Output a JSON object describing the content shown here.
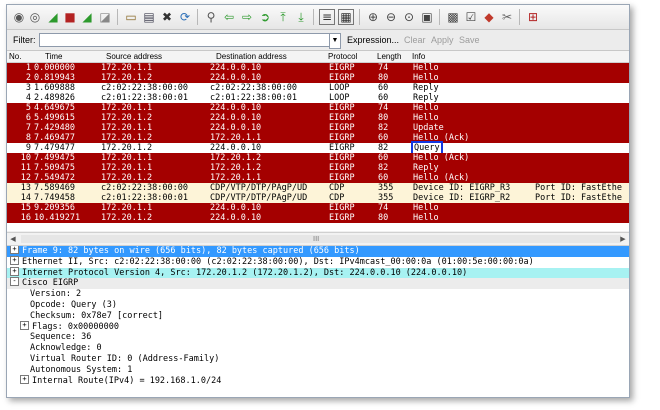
{
  "toolbar": {
    "icons": [
      "list-interfaces-icon",
      "capture-options-icon",
      "start-capture-icon",
      "stop-capture-icon",
      "restart-capture-icon",
      "open-file-icon",
      "save-file-icon",
      "close-file-icon",
      "reload-icon",
      "find-packet-icon",
      "go-back-icon",
      "go-forward-icon",
      "go-to-packet-icon",
      "go-first-icon",
      "go-last-icon",
      "colorize-icon",
      "autoscroll-icon",
      "zoom-in-icon",
      "zoom-out-icon",
      "zoom-normal-icon",
      "resize-columns-icon",
      "capture-filters-icon",
      "display-filters-icon",
      "coloring-rules-icon",
      "preferences-icon",
      "help-icon"
    ]
  },
  "filter": {
    "label": "Filter:",
    "value": "",
    "expression_label": "Expression...",
    "clear_label": "Clear",
    "apply_label": "Apply",
    "save_label": "Save"
  },
  "packet_list": {
    "columns": [
      "No.",
      "Time",
      "Source address",
      "Destination address",
      "Protocol",
      "Length",
      "Info"
    ],
    "rows": [
      {
        "no": "1",
        "time": "0.000000",
        "src": "172.20.1.1",
        "dst": "224.0.0.10",
        "proto": "EIGRP",
        "len": "74",
        "info": "Hello",
        "type": "eigrp"
      },
      {
        "no": "2",
        "time": "0.819943",
        "src": "172.20.1.2",
        "dst": "224.0.0.10",
        "proto": "EIGRP",
        "len": "80",
        "info": "Hello",
        "type": "eigrp"
      },
      {
        "no": "3",
        "time": "1.609888",
        "src": "c2:02:22:38:00:00",
        "dst": "c2:02:22:38:00:00",
        "proto": "LOOP",
        "len": "60",
        "info": "Reply",
        "type": "loop"
      },
      {
        "no": "4",
        "time": "2.489826",
        "src": "c2:01:22:38:00:01",
        "dst": "c2:01:22:38:00:01",
        "proto": "LOOP",
        "len": "60",
        "info": "Reply",
        "type": "loop"
      },
      {
        "no": "5",
        "time": "4.649675",
        "src": "172.20.1.1",
        "dst": "224.0.0.10",
        "proto": "EIGRP",
        "len": "74",
        "info": "Hello",
        "type": "eigrp"
      },
      {
        "no": "6",
        "time": "5.499615",
        "src": "172.20.1.2",
        "dst": "224.0.0.10",
        "proto": "EIGRP",
        "len": "80",
        "info": "Hello",
        "type": "eigrp"
      },
      {
        "no": "7",
        "time": "7.429480",
        "src": "172.20.1.1",
        "dst": "224.0.0.10",
        "proto": "EIGRP",
        "len": "82",
        "info": "Update",
        "type": "eigrp"
      },
      {
        "no": "8",
        "time": "7.469477",
        "src": "172.20.1.2",
        "dst": "172.20.1.1",
        "proto": "EIGRP",
        "len": "60",
        "info": "Hello (Ack)",
        "type": "eigrp"
      },
      {
        "no": "9",
        "time": "7.479477",
        "src": "172.20.1.2",
        "dst": "224.0.0.10",
        "proto": "EIGRP",
        "len": "82",
        "info": "Query",
        "type": "selected"
      },
      {
        "no": "10",
        "time": "7.499475",
        "src": "172.20.1.1",
        "dst": "172.20.1.2",
        "proto": "EIGRP",
        "len": "60",
        "info": "Hello (Ack)",
        "type": "eigrp"
      },
      {
        "no": "11",
        "time": "7.509475",
        "src": "172.20.1.1",
        "dst": "172.20.1.2",
        "proto": "EIGRP",
        "len": "82",
        "info": "Reply",
        "type": "eigrp"
      },
      {
        "no": "12",
        "time": "7.549472",
        "src": "172.20.1.2",
        "dst": "172.20.1.1",
        "proto": "EIGRP",
        "len": "60",
        "info": "Hello (Ack)",
        "type": "eigrp"
      },
      {
        "no": "13",
        "time": "7.589469",
        "src": "c2:02:22:38:00:00",
        "dst": "CDP/VTP/DTP/PAgP/UD",
        "proto": "CDP",
        "len": "355",
        "info": "Device ID: EIGRP_R3",
        "port": "Port ID: FastEthe",
        "type": "cdp"
      },
      {
        "no": "14",
        "time": "7.749458",
        "src": "c2:01:22:38:00:01",
        "dst": "CDP/VTP/DTP/PAgP/UD",
        "proto": "CDP",
        "len": "355",
        "info": "Device ID: EIGRP_R2",
        "port": "Port ID: FastEthe",
        "type": "cdp"
      },
      {
        "no": "15",
        "time": "9.209356",
        "src": "172.20.1.1",
        "dst": "224.0.0.10",
        "proto": "EIGRP",
        "len": "74",
        "info": "Hello",
        "type": "eigrp"
      },
      {
        "no": "16",
        "time": "10.419271",
        "src": "172.20.1.2",
        "dst": "224.0.0.10",
        "proto": "EIGRP",
        "len": "80",
        "info": "Hello",
        "type": "eigrp"
      }
    ]
  },
  "scrollbar": {
    "grip": "III"
  },
  "details": {
    "lines": [
      {
        "text": "Frame 9: 82 bytes on wire (656 bits), 82 bytes captured (656 bits)",
        "indent": 0,
        "expander": "+",
        "style": "sel"
      },
      {
        "text": "Ethernet II, Src: c2:02:22:38:00:00 (c2:02:22:38:00:00), Dst: IPv4mcast_00:00:0a (01:00:5e:00:00:0a)",
        "indent": 0,
        "expander": "+",
        "style": ""
      },
      {
        "text": "Internet Protocol Version 4, Src: 172.20.1.2 (172.20.1.2), Dst: 224.0.0.10 (224.0.0.10)",
        "indent": 0,
        "expander": "+",
        "style": "ip"
      },
      {
        "text": "Cisco EIGRP",
        "indent": 0,
        "expander": "-",
        "style": "cisco"
      },
      {
        "text": "Version: 2",
        "indent": 2,
        "expander": "",
        "style": ""
      },
      {
        "text": "Opcode: Query (3)",
        "indent": 2,
        "expander": "",
        "style": ""
      },
      {
        "text": "Checksum: 0x78e7 [correct]",
        "indent": 2,
        "expander": "",
        "style": ""
      },
      {
        "text": "Flags: 0x00000000",
        "indent": 1,
        "expander": "+",
        "style": ""
      },
      {
        "text": "Sequence: 36",
        "indent": 2,
        "expander": "",
        "style": ""
      },
      {
        "text": "Acknowledge: 0",
        "indent": 2,
        "expander": "",
        "style": ""
      },
      {
        "text": "Virtual Router ID: 0 (Address-Family)",
        "indent": 2,
        "expander": "",
        "style": ""
      },
      {
        "text": "Autonomous System: 1",
        "indent": 2,
        "expander": "",
        "style": ""
      },
      {
        "text": "Internal Route(IPv4)  =   192.168.1.0/24",
        "indent": 1,
        "expander": "+",
        "style": ""
      }
    ]
  }
}
